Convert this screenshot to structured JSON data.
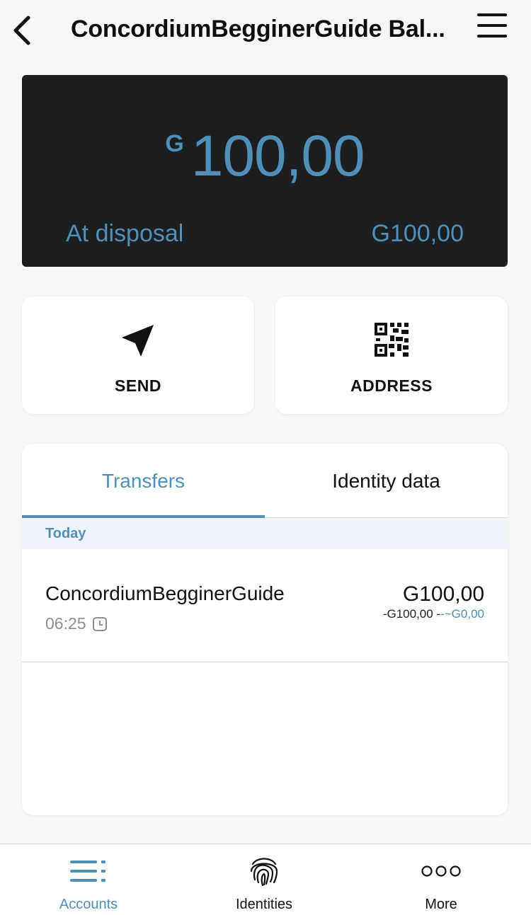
{
  "header": {
    "title": "ConcordiumBegginerGuide Bal..."
  },
  "balance": {
    "currency_symbol": "G",
    "amount": "100,00",
    "disposal_label": "At disposal",
    "disposal_value": "G100,00"
  },
  "actions": {
    "send_label": "SEND",
    "address_label": "ADDRESS"
  },
  "tabs": {
    "transfers": "Transfers",
    "identity": "Identity data",
    "active": "Transfers"
  },
  "transfers": {
    "section": "Today",
    "items": [
      {
        "name": "ConcordiumBegginerGuide",
        "time": "06:25",
        "amount": "G100,00",
        "detail_cost": "-G100,00 -",
        "detail_fee": "-~G0,00"
      }
    ]
  },
  "nav": {
    "accounts": "Accounts",
    "identities": "Identities",
    "more": "More",
    "active": "Accounts"
  },
  "colors": {
    "accent": "#4f8fb8",
    "card": "#1d1e20",
    "background": "#f7f7f8"
  }
}
